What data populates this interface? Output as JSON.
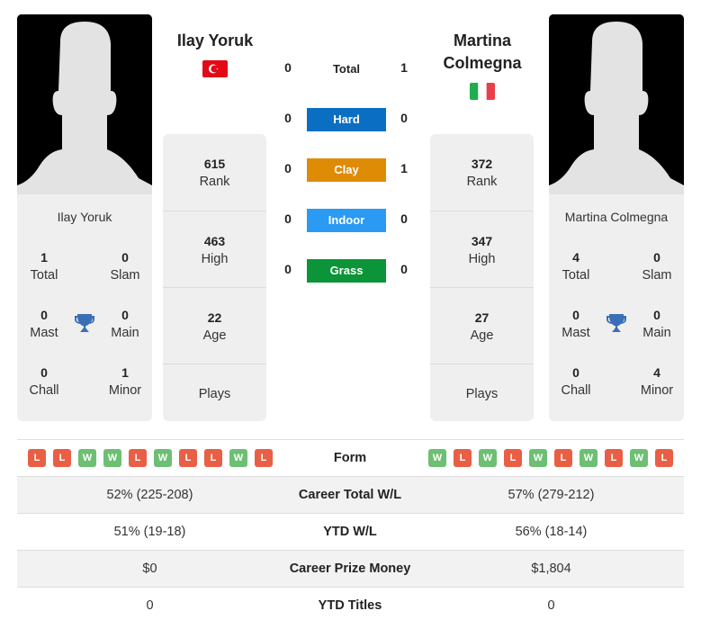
{
  "player1": {
    "name": "Ilay Yoruk",
    "header_name": "Ilay Yoruk",
    "flag": "turkey-flag",
    "titles": {
      "total": {
        "value": "1",
        "label": "Total"
      },
      "slam": {
        "value": "0",
        "label": "Slam"
      },
      "mast": {
        "value": "0",
        "label": "Mast"
      },
      "main": {
        "value": "0",
        "label": "Main"
      },
      "chall": {
        "value": "0",
        "label": "Chall"
      },
      "minor": {
        "value": "1",
        "label": "Minor"
      }
    },
    "stats": {
      "rank": {
        "value": "615",
        "label": "Rank"
      },
      "high": {
        "value": "463",
        "label": "High"
      },
      "age": {
        "value": "22",
        "label": "Age"
      },
      "plays": {
        "value": "",
        "label": "Plays"
      }
    },
    "form": [
      "L",
      "L",
      "W",
      "W",
      "L",
      "W",
      "L",
      "L",
      "W",
      "L"
    ],
    "career_wl": "52% (225-208)",
    "ytd_wl": "51% (19-18)",
    "prize_money": "$0",
    "ytd_titles": "0"
  },
  "player2": {
    "name": "Martina Colmegna",
    "header_name_line1": "Martina",
    "header_name_line2": "Colmegna",
    "flag": "italy-flag",
    "titles": {
      "total": {
        "value": "4",
        "label": "Total"
      },
      "slam": {
        "value": "0",
        "label": "Slam"
      },
      "mast": {
        "value": "0",
        "label": "Mast"
      },
      "main": {
        "value": "0",
        "label": "Main"
      },
      "chall": {
        "value": "0",
        "label": "Chall"
      },
      "minor": {
        "value": "4",
        "label": "Minor"
      }
    },
    "stats": {
      "rank": {
        "value": "372",
        "label": "Rank"
      },
      "high": {
        "value": "347",
        "label": "High"
      },
      "age": {
        "value": "27",
        "label": "Age"
      },
      "plays": {
        "value": "",
        "label": "Plays"
      }
    },
    "form": [
      "W",
      "L",
      "W",
      "L",
      "W",
      "L",
      "W",
      "L",
      "W",
      "L"
    ],
    "career_wl": "57% (279-212)",
    "ytd_wl": "56% (18-14)",
    "prize_money": "$1,804",
    "ytd_titles": "0"
  },
  "h2h": {
    "total": {
      "label": "Total",
      "p1": "0",
      "p2": "1"
    },
    "surfaces": [
      {
        "label": "Hard",
        "p1": "0",
        "p2": "0",
        "color": "#0a6fc2"
      },
      {
        "label": "Clay",
        "p1": "0",
        "p2": "1",
        "color": "#de8c05"
      },
      {
        "label": "Indoor",
        "p1": "0",
        "p2": "0",
        "color": "#2b9af3"
      },
      {
        "label": "Grass",
        "p1": "0",
        "p2": "0",
        "color": "#0c9438"
      }
    ]
  },
  "table_labels": {
    "form": "Form",
    "career_wl": "Career Total W/L",
    "ytd_wl": "YTD W/L",
    "prize_money": "Career Prize Money",
    "ytd_titles": "YTD Titles"
  },
  "colors": {
    "win": "#6dbf73",
    "loss": "#e95f45",
    "trophy": "#3a6fb8"
  }
}
